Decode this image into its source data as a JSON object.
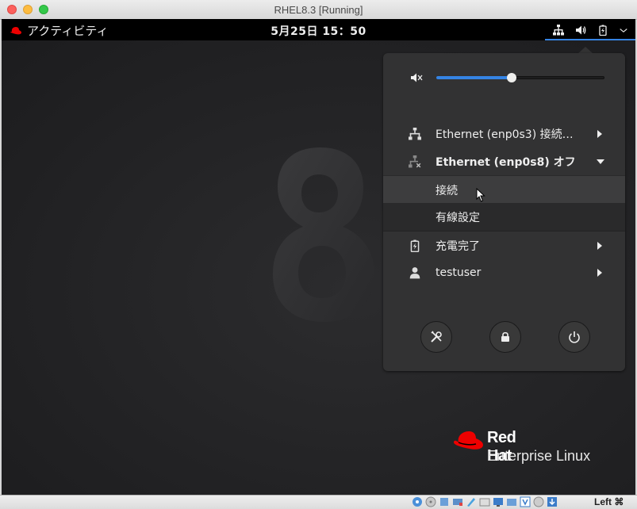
{
  "window": {
    "title": "RHEL8.3 [Running]"
  },
  "topbar": {
    "activities": "アクティビティ",
    "clock": "5月25日  15：50",
    "icons": [
      "network-wired-icon",
      "volume-icon",
      "battery-charging-icon",
      "chevron-down-icon"
    ]
  },
  "menu": {
    "volume": {
      "level": 0.45,
      "icon": "speaker-muted-icon"
    },
    "items": [
      {
        "label": "Ethernet (enp0s3) 接続…",
        "icon": "network-wired-icon"
      },
      {
        "label": "Ethernet (enp0s8) オフ",
        "icon": "network-wired-disconnected-icon"
      },
      {
        "label": "充電完了",
        "icon": "battery-charging-icon"
      },
      {
        "label": "testuser",
        "icon": "user-icon"
      }
    ],
    "submenu": [
      {
        "label": "接続"
      },
      {
        "label": "有線設定"
      }
    ],
    "buttons": [
      "settings-icon",
      "lock-icon",
      "power-icon"
    ]
  },
  "branding": {
    "logo_name": "Red Hat",
    "logo_sub": "Enterprise Linux",
    "watermark": "8"
  },
  "statusbar": {
    "host_key": "Left ⌘"
  },
  "colors": {
    "accent": "#3584e4",
    "menu_bg": "#323233",
    "redhat": "#ee0000"
  }
}
